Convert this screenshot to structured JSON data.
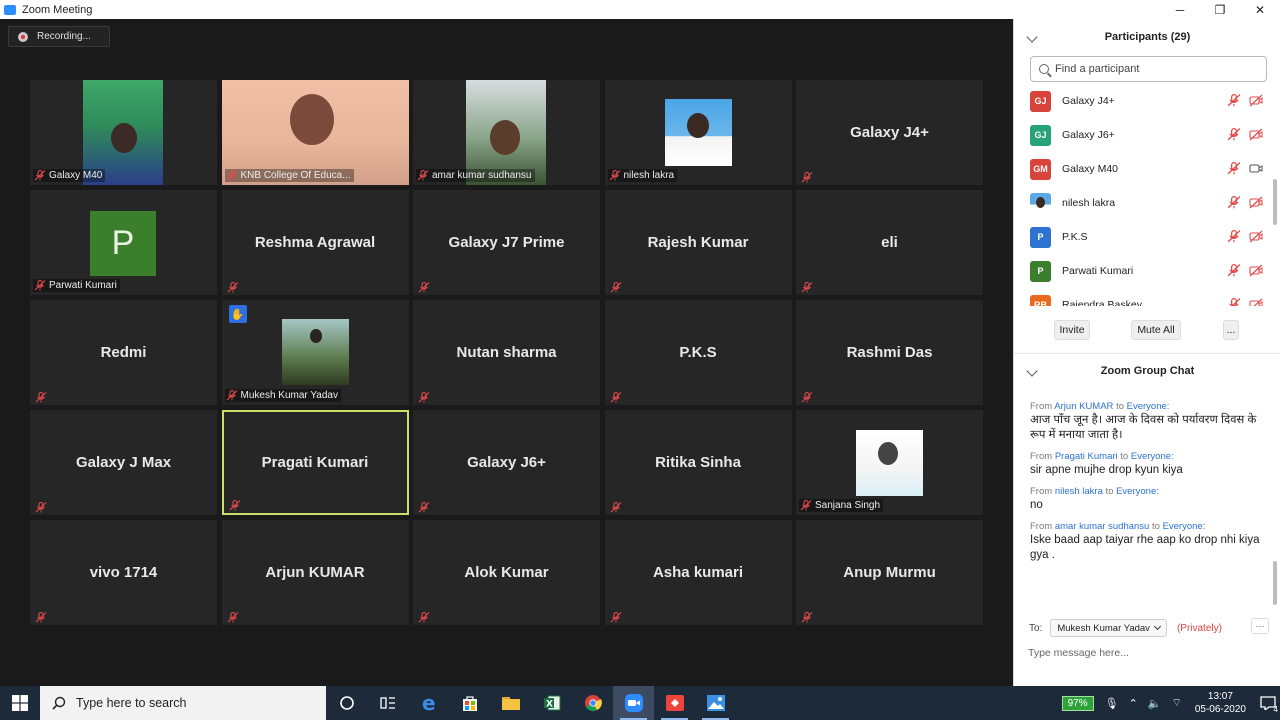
{
  "window": {
    "title": "Zoom Meeting",
    "minimize": "─",
    "maximize": "❐",
    "close": "✕"
  },
  "recording": {
    "label": "Recording..."
  },
  "tiles": [
    {
      "name": "Galaxy M40",
      "kind": "video"
    },
    {
      "name": "KNB College Of Educa...",
      "kind": "video"
    },
    {
      "name": "amar kumar sudhansu",
      "kind": "video"
    },
    {
      "name": "nilesh lakra",
      "kind": "video"
    },
    {
      "name": "Galaxy J4+",
      "kind": "name"
    },
    {
      "name": "Parwati Kumari",
      "kind": "avatar",
      "initial": "P"
    },
    {
      "name": "Reshma Agrawal",
      "kind": "name"
    },
    {
      "name": "Galaxy J7 Prime",
      "kind": "name"
    },
    {
      "name": "Rajesh Kumar",
      "kind": "name"
    },
    {
      "name": "eli",
      "kind": "name"
    },
    {
      "name": "Redmi",
      "kind": "name"
    },
    {
      "name": "Mukesh Kumar Yadav",
      "kind": "video",
      "hand": true
    },
    {
      "name": "Nutan sharma",
      "kind": "name"
    },
    {
      "name": "P.K.S",
      "kind": "name"
    },
    {
      "name": "Rashmi Das",
      "kind": "name"
    },
    {
      "name": "Galaxy J Max",
      "kind": "name"
    },
    {
      "name": "Pragati Kumari",
      "kind": "name",
      "active": true
    },
    {
      "name": "Galaxy J6+",
      "kind": "name"
    },
    {
      "name": "Ritika Sinha",
      "kind": "name"
    },
    {
      "name": "Sanjana Singh",
      "kind": "video"
    },
    {
      "name": "vivo 1714",
      "kind": "name"
    },
    {
      "name": "Arjun KUMAR",
      "kind": "name"
    },
    {
      "name": "Alok Kumar",
      "kind": "name"
    },
    {
      "name": "Asha kumari",
      "kind": "name"
    },
    {
      "name": "Anup Murmu",
      "kind": "name"
    }
  ],
  "participants": {
    "title": "Participants (29)",
    "search_placeholder": "Find a participant",
    "list": [
      {
        "initials": "GJ",
        "name": "Galaxy J4+",
        "color": "#d9443a",
        "video": "off"
      },
      {
        "initials": "GJ",
        "name": "Galaxy J6+",
        "color": "#27a37a",
        "video": "off"
      },
      {
        "initials": "GM",
        "name": "Galaxy M40",
        "color": "#d9443a",
        "video": "on"
      },
      {
        "initials": "",
        "name": "nilesh lakra",
        "color": "#7a8fa8",
        "video": "off"
      },
      {
        "initials": "P",
        "name": "P.K.S",
        "color": "#2d73d2",
        "video": "off"
      },
      {
        "initials": "P",
        "name": "Parwati Kumari",
        "color": "#3b7f2c",
        "video": "off"
      },
      {
        "initials": "RB",
        "name": "Rajendra Baskey",
        "color": "#e86a1f",
        "video": "off"
      }
    ],
    "invite": "Invite",
    "mute_all": "Mute All",
    "more": "..."
  },
  "chat": {
    "title": "Zoom Group Chat",
    "messages": [
      {
        "from": "Arjun KUMAR",
        "to": "Everyone:",
        "text": "आज पाँच जून है। आज के दिवस को पर्यावरण दिवस के रूप में मनाया जाता है।"
      },
      {
        "from": "Pragati Kumari",
        "to": "Everyone:",
        "text": "sir apne mujhe drop kyun kiya"
      },
      {
        "from": "nilesh lakra",
        "to": "Everyone:",
        "text": "no"
      },
      {
        "from": "amar kumar sudhansu",
        "to": "Everyone:",
        "text": "Iske baad aap taiyar rhe aap ko drop nhi kiya gya ."
      }
    ],
    "from_word": "From",
    "to_word": "to",
    "to_label": "To:",
    "recipient": "Mukesh Kumar Yadav",
    "privately": "(Privately)",
    "more": "···",
    "input_placeholder": "Type message here..."
  },
  "taskbar": {
    "search_placeholder": "Type here to search",
    "battery": "97%",
    "time": "13:07",
    "date": "05-06-2020",
    "notifications": "4"
  }
}
